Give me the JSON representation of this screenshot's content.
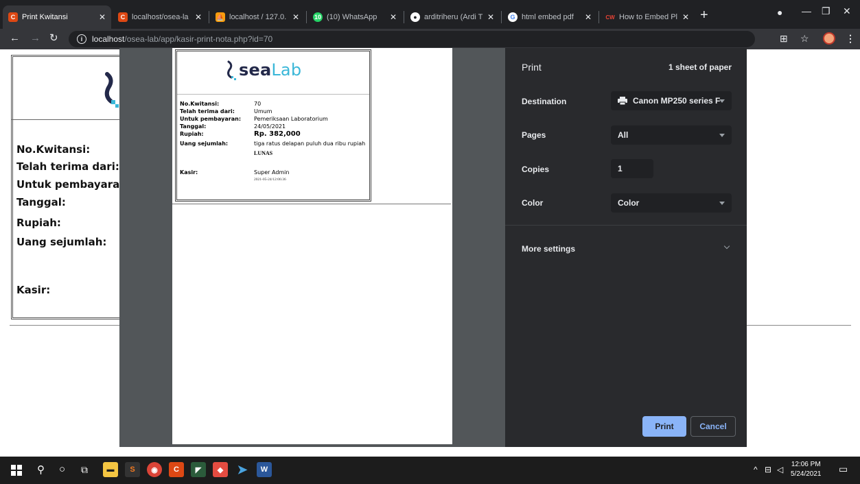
{
  "browser": {
    "tabs": [
      {
        "title": "Print Kwitansi",
        "favicon": "codeigniter-icon",
        "active": true
      },
      {
        "title": "localhost/osea-la",
        "favicon": "codeigniter-icon",
        "active": false
      },
      {
        "title": "localhost / 127.0.",
        "favicon": "phpmyadmin-icon",
        "active": false
      },
      {
        "title": "(10) WhatsApp",
        "favicon": "whatsapp-icon",
        "active": false
      },
      {
        "title": "arditriheru (Ardi T",
        "favicon": "github-icon",
        "active": false
      },
      {
        "title": "html embed pdf",
        "favicon": "google-icon",
        "active": false
      },
      {
        "title": "How to Embed Pl",
        "favicon": "cw-icon",
        "active": false
      }
    ],
    "url_host": "localhost",
    "url_path": "/osea-lab/app/kasir-print-nota.php?id=70"
  },
  "background_page": {
    "labels": [
      "No.Kwitansi:",
      "Telah terima dari:",
      "Untuk pembayaran",
      "Tanggal:",
      "Rupiah:",
      "Uang sejumlah:",
      "Kasir:"
    ]
  },
  "receipt": {
    "logo_sea": "sea",
    "logo_lab": "Lab",
    "rows": [
      {
        "label": "No.Kwitansi:",
        "value": "70"
      },
      {
        "label": "Telah terima dari:",
        "value": "Umum"
      },
      {
        "label": "Untuk pembayaran:",
        "value": "Pemeriksaan Laboratorium"
      },
      {
        "label": "Tanggal:",
        "value": "24/05/2021"
      },
      {
        "label": "Rupiah:",
        "value": "Rp. 382,000"
      },
      {
        "label": "Uang sejumlah:",
        "value": "tiga ratus delapan puluh dua ribu rupiah"
      },
      {
        "label": "Kasir:",
        "value": "Super Admin"
      }
    ],
    "status": "LUNAS",
    "timestamp": "2021-05-24/12:06:36"
  },
  "print_dialog": {
    "title": "Print",
    "sheets": "1 sheet of paper",
    "destination_label": "Destination",
    "destination_value": "Canon MP250 series F",
    "pages_label": "Pages",
    "pages_value": "All",
    "copies_label": "Copies",
    "copies_value": "1",
    "color_label": "Color",
    "color_value": "Color",
    "more_settings": "More settings",
    "print_button": "Print",
    "cancel_button": "Cancel"
  },
  "taskbar": {
    "time": "12:06 PM",
    "date": "5/24/2021"
  },
  "colors": {
    "accent": "#8ab4f8",
    "panel_bg": "#292a2d",
    "logo_dark": "#23294a",
    "logo_cyan": "#3ab7d8"
  }
}
